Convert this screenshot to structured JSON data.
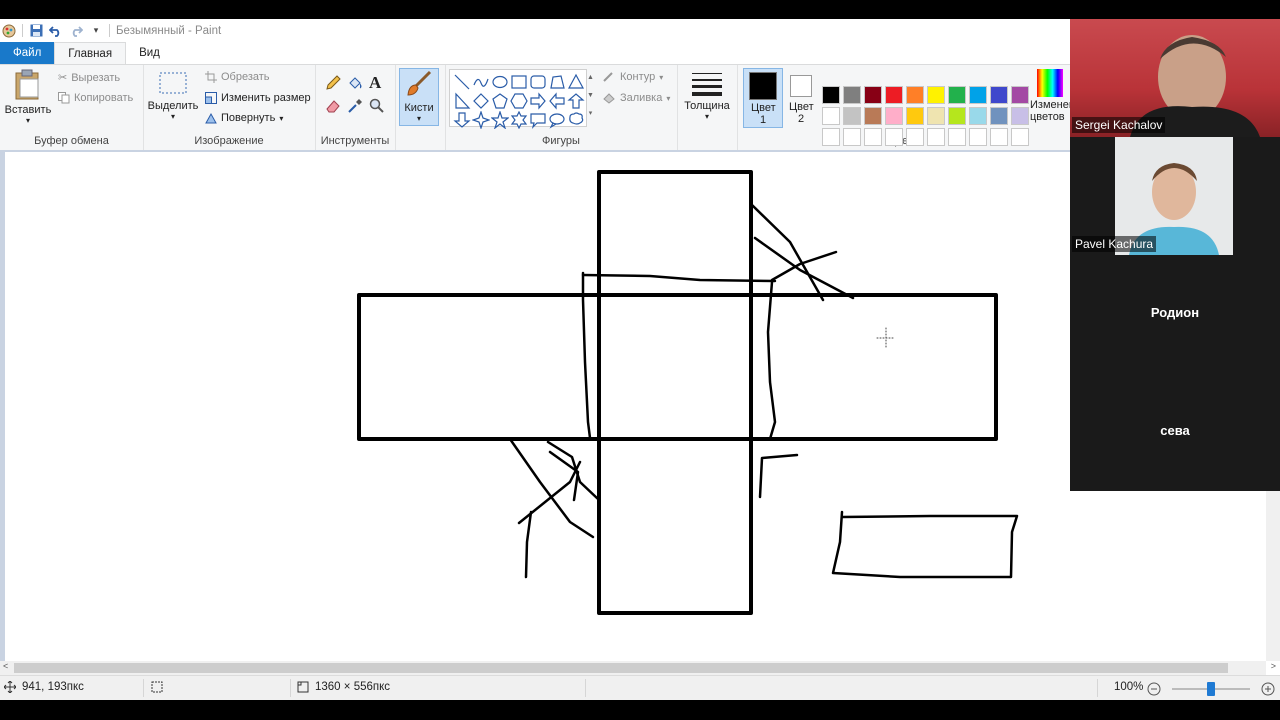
{
  "app": {
    "title": "Безымянный - Paint"
  },
  "tabs": [
    {
      "label": "Файл"
    },
    {
      "label": "Главная"
    },
    {
      "label": "Вид"
    }
  ],
  "ribbon": {
    "clipboard": {
      "group_label": "Буфер обмена",
      "paste": "Вставить",
      "cut": "Вырезать",
      "copy": "Копировать"
    },
    "image": {
      "group_label": "Изображение",
      "select": "Выделить",
      "crop": "Обрезать",
      "resize": "Изменить размер",
      "rotate": "Повернуть"
    },
    "tools": {
      "group_label": "Инструменты"
    },
    "brushes": {
      "label": "Кисти"
    },
    "shapes": {
      "group_label": "Фигуры",
      "outline": "Контур",
      "fill": "Заливка"
    },
    "size": {
      "label": "Толщина"
    },
    "colors": {
      "group_label": "Цвета",
      "color1": "Цвет 1",
      "color2": "Цвет 2",
      "edit": "Изменение цветов",
      "palette": [
        "#000000",
        "#7f7f7f",
        "#880015",
        "#ed1c24",
        "#ff7f27",
        "#fff200",
        "#22b14c",
        "#00a2e8",
        "#3f48cc",
        "#a349a4",
        "#ffffff",
        "#c3c3c3",
        "#b97a57",
        "#ffaec9",
        "#ffc90e",
        "#efe4b0",
        "#b5e61d",
        "#99d9ea",
        "#7092be",
        "#c8bfe7",
        "#ffffff",
        "#ffffff",
        "#ffffff",
        "#ffffff",
        "#ffffff",
        "#ffffff",
        "#ffffff",
        "#ffffff",
        "#ffffff",
        "#ffffff"
      ]
    }
  },
  "status": {
    "cursor_pos": "941, 193пкс",
    "selection_size": "",
    "image_size": "1360 × 556пкс",
    "zoom": "100%",
    "zoom_fraction": 0.5
  },
  "video": {
    "participants": [
      {
        "name": "Sergei Kachalov"
      },
      {
        "name": "Pavel Kachura"
      },
      {
        "name": "Родион"
      },
      {
        "name": "сева"
      }
    ]
  }
}
